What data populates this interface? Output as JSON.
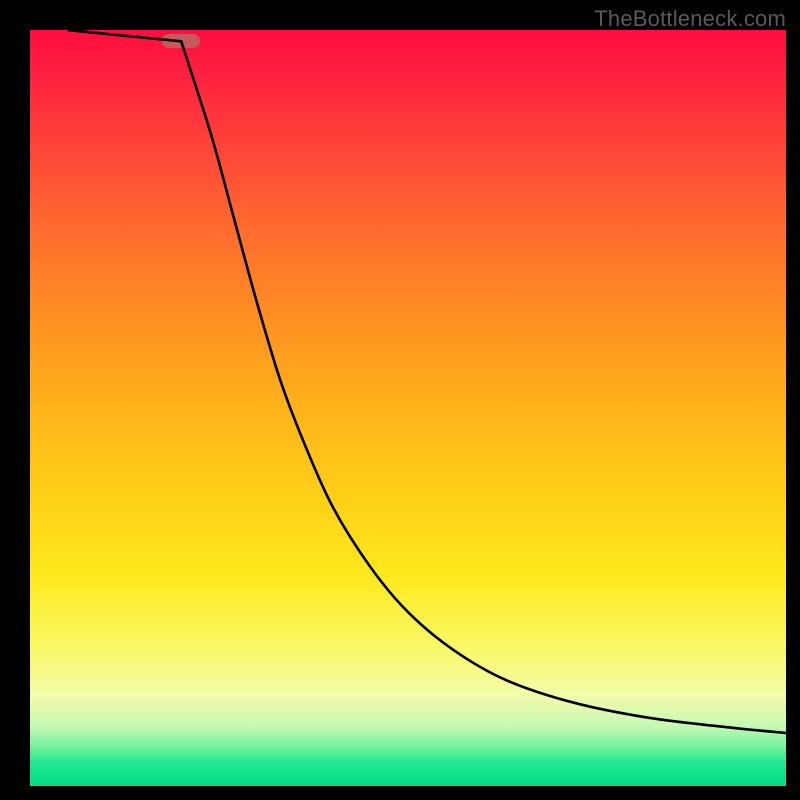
{
  "watermark": "TheBottleneck.com",
  "chart_data": {
    "type": "line",
    "title": "",
    "xlabel": "",
    "ylabel": "",
    "xlim": [
      0,
      100
    ],
    "ylim": [
      0,
      100
    ],
    "grid": false,
    "legend": false,
    "marker": {
      "x": 20,
      "y": 98.5,
      "shape": "pill",
      "color": "#c45a5a"
    },
    "series": [
      {
        "name": "left-descent",
        "x": [
          5,
          20
        ],
        "y": [
          100,
          98.5
        ],
        "segment": "linear"
      },
      {
        "name": "right-curve",
        "x": [
          20,
          24,
          27,
          30,
          33,
          36,
          40,
          45,
          50,
          56,
          63,
          72,
          82,
          92,
          100
        ],
        "y": [
          98.5,
          86,
          75,
          64,
          54,
          46,
          37,
          29,
          23,
          18,
          14,
          11,
          9,
          7.8,
          7
        ],
        "segment": "smooth"
      }
    ]
  },
  "colors": {
    "curve_stroke": "#000000",
    "background_frame": "#000000",
    "watermark": "#5a5a5a"
  }
}
